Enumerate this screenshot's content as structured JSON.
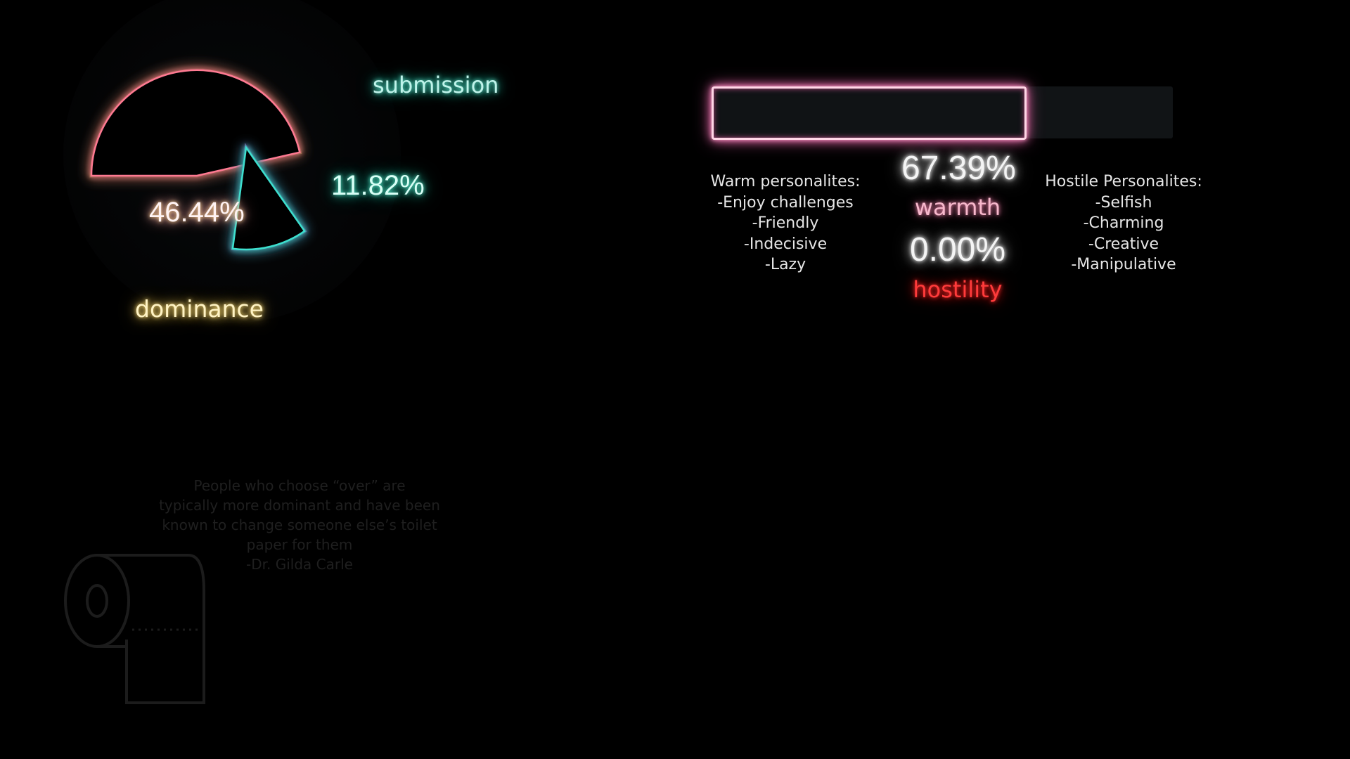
{
  "pie_chart": {
    "slices": [
      {
        "name": "dominance",
        "label": "dominance",
        "percent_text": "46.44%",
        "value": 46.44,
        "color": "#ff7a92",
        "glow": "#f2d36a"
      },
      {
        "name": "submission",
        "label": "submission",
        "percent_text": "11.82%",
        "value": 11.82,
        "color": "#3de0cf",
        "glow": "#b98cff"
      }
    ]
  },
  "warmth_panel": {
    "warmth_percent_text": "67.39%",
    "warmth_label": "warmth",
    "warmth_value": 67.39,
    "hostility_percent_text": "0.00%",
    "hostility_label": "hostility",
    "hostility_value": 0.0,
    "warm_heading": "Warm personalites:",
    "warm_traits": [
      "-Enjoy challenges",
      "-Friendly",
      "-Indecisive",
      "-Lazy"
    ],
    "hostile_heading": "Hostile Personalites:",
    "hostile_traits": [
      "-Selfish",
      "-Charming",
      "-Creative",
      "-Manipulative"
    ],
    "bar_color": "#f59ac4"
  },
  "quote": {
    "lines": [
      "People who choose “over” are",
      "typically more dominant and have been",
      "known to change someone else’s toilet",
      "paper for them",
      "-Dr. Gilda Carle"
    ]
  },
  "decor": {
    "toilet_paper_icon": "toilet-paper-icon"
  }
}
